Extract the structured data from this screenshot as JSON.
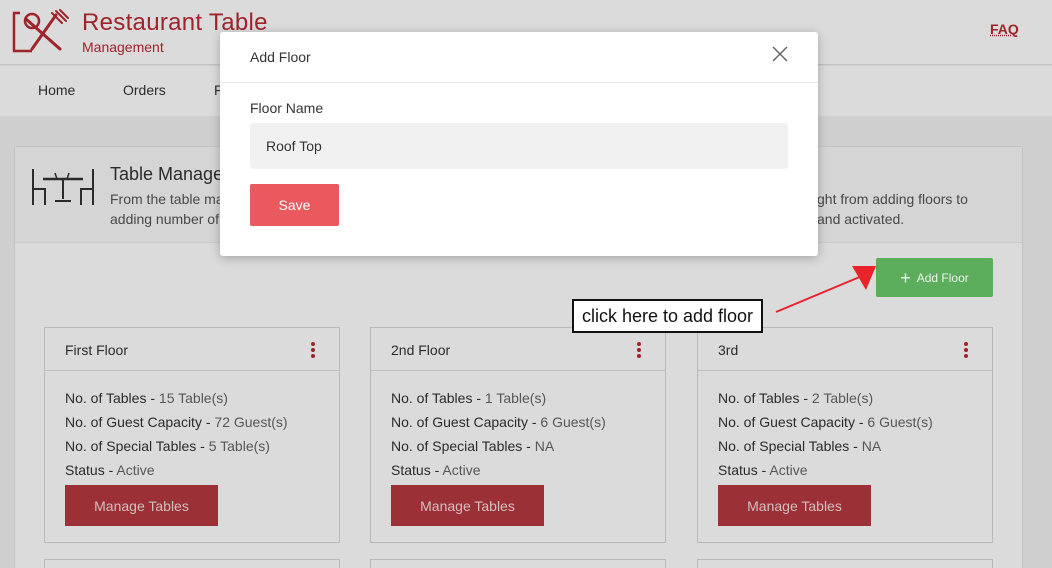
{
  "header": {
    "brand_title": "Restaurant Table",
    "brand_subtitle": "Management",
    "faq_label": "FAQ",
    "logo_icon": "fork-knife-logo-icon"
  },
  "nav": {
    "items": [
      {
        "label": "Home"
      },
      {
        "label": "Orders"
      },
      {
        "label": "F"
      }
    ]
  },
  "panel": {
    "title": "Table Manage",
    "description_left": [
      "From the table ma",
      "adding number of"
    ],
    "description_right": [
      "ght from adding floors to",
      "and activated."
    ],
    "icon": "dining-table-icon"
  },
  "add_floor": {
    "label": "Add Floor",
    "icon": "plus-icon",
    "color": "#5cad5c"
  },
  "callout": {
    "text": "click here to add floor",
    "arrow_color": "#e8232b"
  },
  "cards": [
    {
      "title": "First Floor",
      "tables_label": "No. of Tables - ",
      "tables_value": "15 Table(s)",
      "guest_label": "No. of Guest Capacity - ",
      "guest_value": "72 Guest(s)",
      "special_label": "No. of Special Tables - ",
      "special_value": "5 Table(s)",
      "status_label": "Status - ",
      "status_value": "Active",
      "button": "Manage Tables"
    },
    {
      "title": "2nd Floor",
      "tables_label": "No. of Tables - ",
      "tables_value": "1 Table(s)",
      "guest_label": "No. of Guest Capacity - ",
      "guest_value": "6 Guest(s)",
      "special_label": "No. of Special Tables - ",
      "special_value": "NA",
      "status_label": "Status - ",
      "status_value": "Active",
      "button": "Manage Tables"
    },
    {
      "title": "3rd",
      "tables_label": "No. of Tables - ",
      "tables_value": "2 Table(s)",
      "guest_label": "No. of Guest Capacity - ",
      "guest_value": "6 Guest(s)",
      "special_label": "No. of Special Tables - ",
      "special_value": "NA",
      "status_label": "Status - ",
      "status_value": "Active",
      "button": "Manage Tables"
    }
  ],
  "modal": {
    "title": "Add Floor",
    "close_icon": "close-icon",
    "field_label": "Floor Name",
    "field_value": "Roof Top",
    "save_label": "Save",
    "save_color": "#e9595e"
  },
  "colors": {
    "brand": "#b92b33",
    "manage_button": "#b53941"
  }
}
